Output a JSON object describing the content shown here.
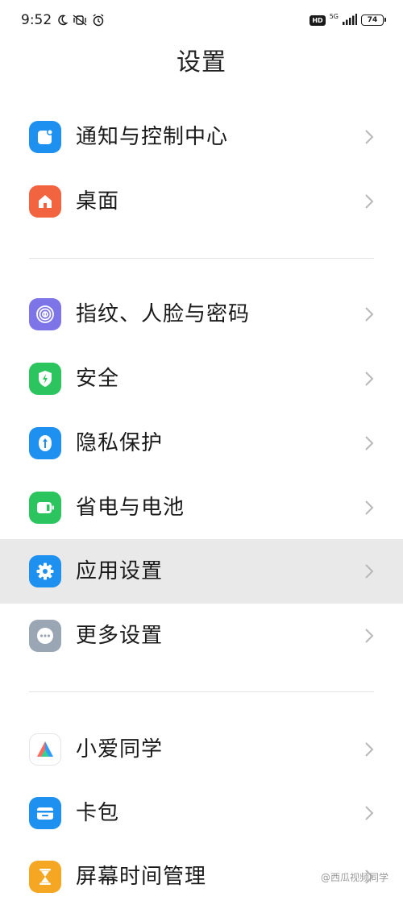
{
  "status_bar": {
    "time": "9:52",
    "left_icons": [
      "moon-icon",
      "vibrate-icon",
      "alarm-icon"
    ],
    "hd_badge": "HD",
    "network": "5G",
    "battery": "74"
  },
  "page": {
    "title": "设置"
  },
  "groups": [
    {
      "items": [
        {
          "label": "通知与控制中心",
          "icon": "notification-icon",
          "color": "#1e90f0"
        },
        {
          "label": "桌面",
          "icon": "home-icon",
          "color": "#f2633f"
        }
      ]
    },
    {
      "items": [
        {
          "label": "指纹、人脸与密码",
          "icon": "fingerprint-icon",
          "color": "#7d74e8"
        },
        {
          "label": "安全",
          "icon": "shield-bolt-icon",
          "color": "#2bc45f"
        },
        {
          "label": "隐私保护",
          "icon": "privacy-icon",
          "color": "#1e90f0"
        },
        {
          "label": "省电与电池",
          "icon": "battery-icon",
          "color": "#2bc45f"
        },
        {
          "label": "应用设置",
          "icon": "gear-icon",
          "color": "#1e90f0",
          "selected": true
        },
        {
          "label": "更多设置",
          "icon": "more-icon",
          "color": "#9aa6b4"
        }
      ]
    },
    {
      "items": [
        {
          "label": "小爱同学",
          "icon": "xiaoai-icon",
          "color": "#ffffff"
        },
        {
          "label": "卡包",
          "icon": "wallet-icon",
          "color": "#1e90f0"
        },
        {
          "label": "屏幕时间管理",
          "icon": "hourglass-icon",
          "color": "#f5a623"
        }
      ]
    }
  ],
  "watermark": "@西瓜视频同学"
}
